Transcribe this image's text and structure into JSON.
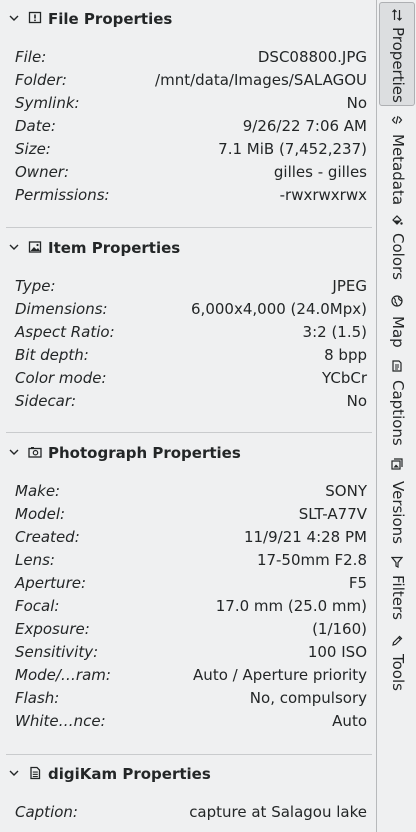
{
  "groups": [
    {
      "title": "File Properties",
      "icon": "info-icon",
      "rows": [
        {
          "label": "File:",
          "value": "DSC08800.JPG"
        },
        {
          "label": "Folder:",
          "value": "/mnt/data/Images/SALAGOU"
        },
        {
          "label": "Symlink:",
          "value": "No"
        },
        {
          "label": "Date:",
          "value": "9/26/22 7:06 AM"
        },
        {
          "label": "Size:",
          "value": "7.1 MiB (7,452,237)"
        },
        {
          "label": "Owner:",
          "value": "gilles - gilles"
        },
        {
          "label": "Permissions:",
          "value": "-rwxrwxrwx"
        }
      ]
    },
    {
      "title": "Item Properties",
      "icon": "image-icon",
      "rows": [
        {
          "label": "Type:",
          "value": "JPEG"
        },
        {
          "label": "Dimensions:",
          "value": "6,000x4,000 (24.0Mpx)"
        },
        {
          "label": "Aspect Ratio:",
          "value": "3:2 (1.5)"
        },
        {
          "label": "Bit depth:",
          "value": "8 bpp"
        },
        {
          "label": "Color mode:",
          "value": "YCbCr"
        },
        {
          "label": "Sidecar:",
          "value": "No"
        }
      ]
    },
    {
      "title": "Photograph Properties",
      "icon": "camera-icon",
      "rows": [
        {
          "label": "Make:",
          "value": "SONY"
        },
        {
          "label": "Model:",
          "value": "SLT-A77V"
        },
        {
          "label": "Created:",
          "value": "11/9/21 4:28 PM"
        },
        {
          "label": "Lens:",
          "value": "17-50mm F2.8"
        },
        {
          "label": "Aperture:",
          "value": "F5"
        },
        {
          "label": "Focal:",
          "value": "17.0 mm (25.0 mm)"
        },
        {
          "label": "Exposure:",
          "value": "(1/160)"
        },
        {
          "label": "Sensitivity:",
          "value": "100 ISO"
        },
        {
          "label": "Mode/…ram:",
          "value": "Auto / Aperture priority"
        },
        {
          "label": "Flash:",
          "value": "No, compulsory"
        },
        {
          "label": "White…nce:",
          "value": "Auto"
        }
      ]
    },
    {
      "title": "digiKam Properties",
      "icon": "document-icon",
      "rows": [
        {
          "label": "Caption:",
          "value": "capture at Salagou lake"
        }
      ]
    }
  ],
  "tabs": [
    {
      "label": "Properties",
      "icon": "sliders-icon",
      "active": true
    },
    {
      "label": "Metadata",
      "icon": "code-icon",
      "active": false
    },
    {
      "label": "Colors",
      "icon": "paint-bucket-icon",
      "active": false
    },
    {
      "label": "Map",
      "icon": "globe-icon",
      "active": false
    },
    {
      "label": "Captions",
      "icon": "note-icon",
      "active": false
    },
    {
      "label": "Versions",
      "icon": "versions-icon",
      "active": false
    },
    {
      "label": "Filters",
      "icon": "funnel-icon",
      "active": false
    },
    {
      "label": "Tools",
      "icon": "pencil-icon",
      "active": false
    }
  ],
  "colors": {
    "background": "#eff0f1",
    "text": "#232627",
    "active_tab": "#dcdee0"
  }
}
